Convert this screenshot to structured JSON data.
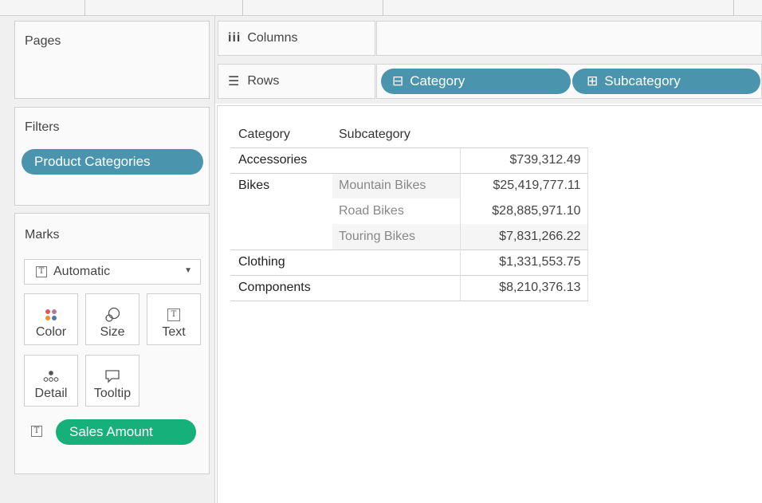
{
  "cards": {
    "pages_title": "Pages",
    "filters_title": "Filters",
    "filter_pill": "Product Categories",
    "marks_title": "Marks"
  },
  "marks": {
    "type_value": "Automatic",
    "type_icon": "T",
    "buttons": {
      "color": "Color",
      "size": "Size",
      "text": "Text",
      "detail": "Detail",
      "tooltip": "Tooltip"
    },
    "field_pill": "Sales Amount"
  },
  "shelves": {
    "columns_label": "Columns",
    "columns_icon": "iii",
    "rows_label": "Rows",
    "rows_pills": [
      {
        "label": "Category",
        "toggle": "⊟"
      },
      {
        "label": "Subcategory",
        "toggle": "⊞"
      }
    ]
  },
  "table": {
    "headers": [
      "Category",
      "Subcategory"
    ],
    "rows": [
      {
        "category": "Accessories",
        "subcategory": "",
        "value": "$739,312.49"
      },
      {
        "category": "Bikes",
        "subcategory": "Mountain Bikes",
        "value": "$25,419,777.11"
      },
      {
        "category": "",
        "subcategory": "Road Bikes",
        "value": "$28,885,971.10"
      },
      {
        "category": "",
        "subcategory": "Touring Bikes",
        "value": "$7,831,266.22"
      },
      {
        "category": "Clothing",
        "subcategory": "",
        "value": "$1,331,553.75"
      },
      {
        "category": "Components",
        "subcategory": "",
        "value": "$8,210,376.13"
      }
    ]
  },
  "colors": {
    "dimension_pill": "#4a95ad",
    "measure_pill": "#16b07a"
  }
}
